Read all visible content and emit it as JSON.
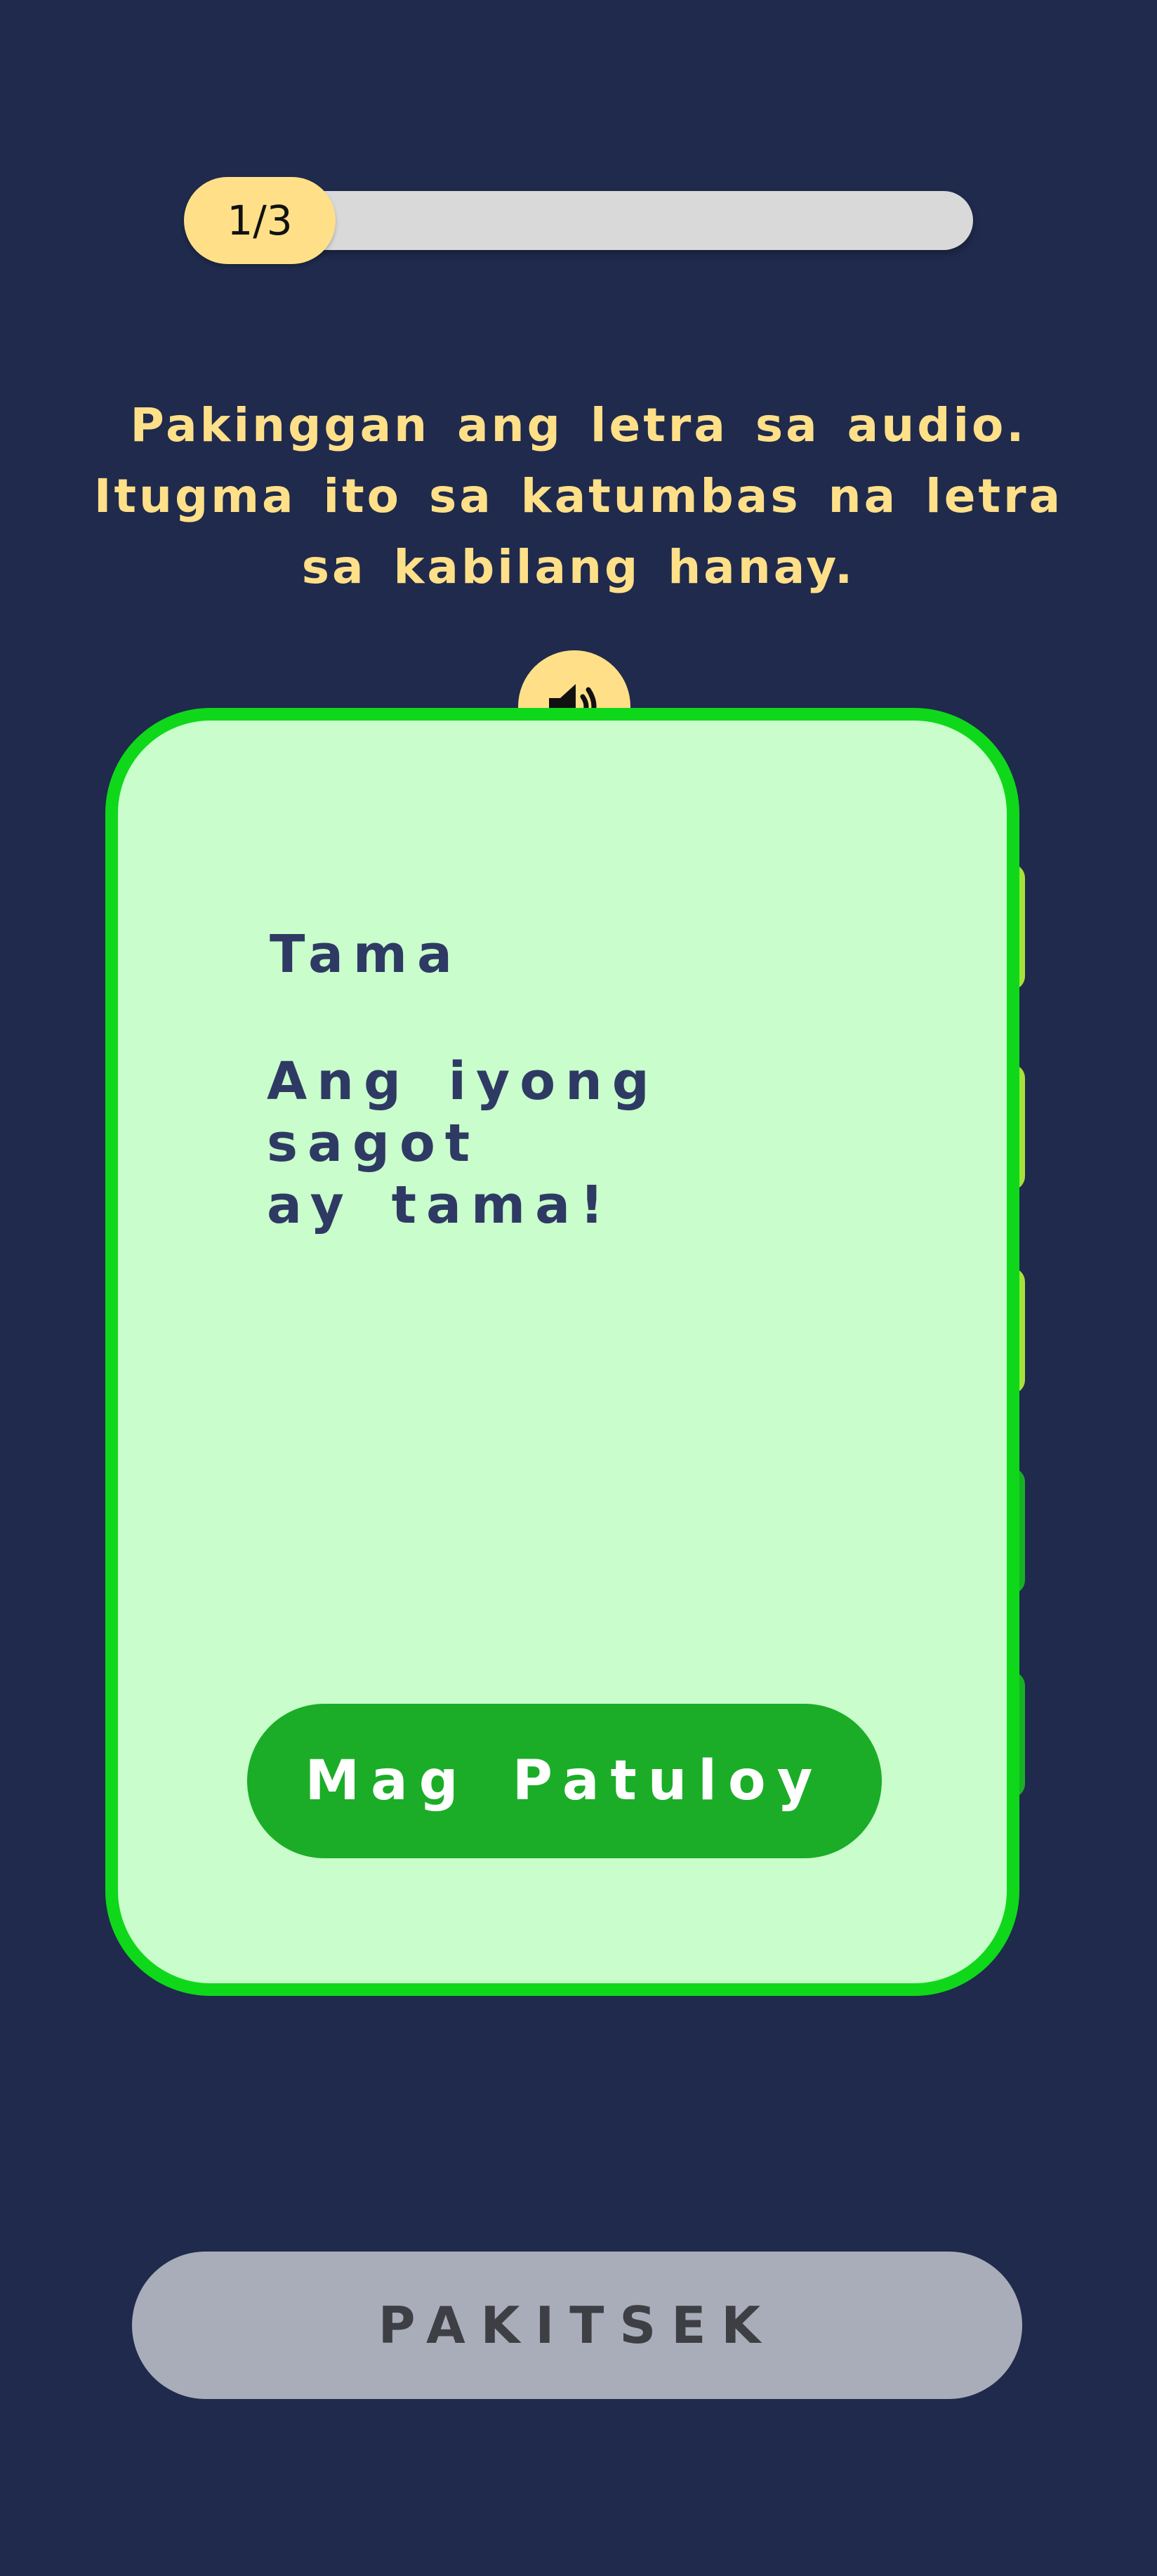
{
  "progress": {
    "label": "1/3",
    "current": 1,
    "total": 3
  },
  "instruction": {
    "line1": "Pakinggan  ang letra sa  audio.",
    "line2": "Itugma  ito sa  katumbas na  letra",
    "line3": "sa  kabilang  hanay."
  },
  "audio_button": {
    "icon": "speaker-icon"
  },
  "feedback": {
    "title": "Tama",
    "message_line1": "Ang iyong sagot",
    "message_line2": "ay tama!",
    "continue_label": "Mag Patuloy",
    "accent": "#0fd81a",
    "background": "#c9fdcb"
  },
  "footer": {
    "check_label": "PAKITSEK"
  },
  "colors": {
    "page_background": "#1f2a4d",
    "highlight_yellow": "#ffe088",
    "button_green": "#1bad27",
    "disabled_gray": "#a8adb9"
  }
}
